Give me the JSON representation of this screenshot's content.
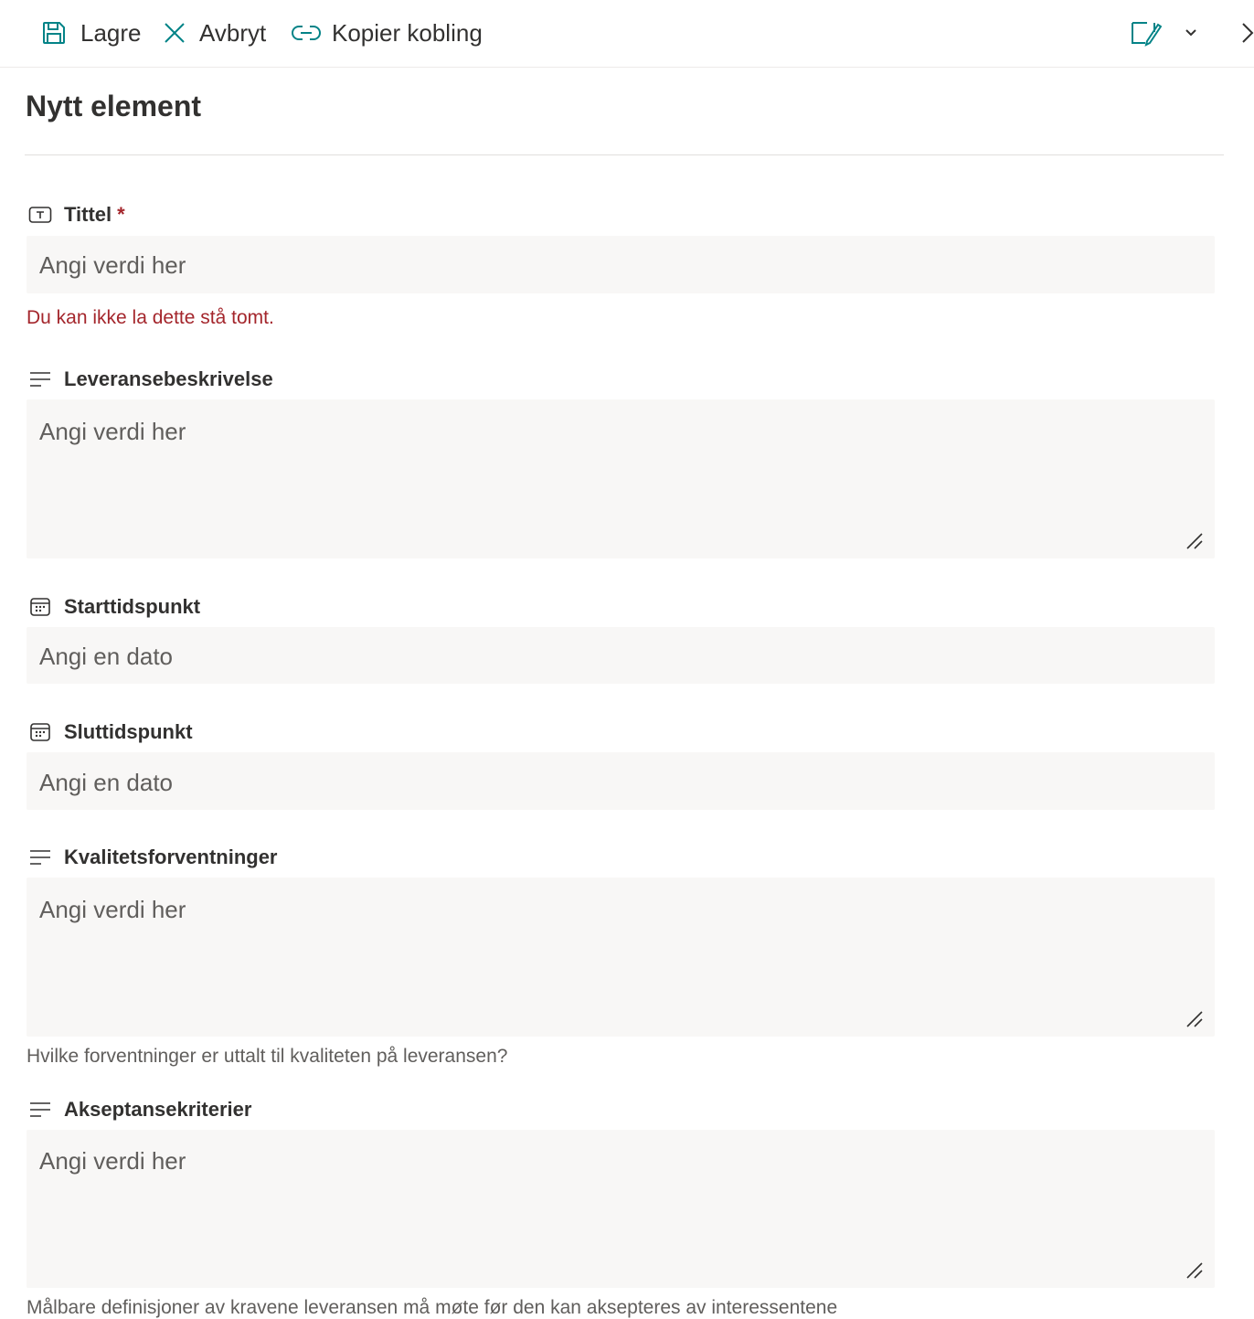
{
  "toolbar": {
    "save_label": "Lagre",
    "cancel_label": "Avbryt",
    "copy_link_label": "Kopier kobling"
  },
  "page": {
    "title": "Nytt element"
  },
  "fields": {
    "tittel": {
      "label": "Tittel",
      "required_mark": "*",
      "placeholder": "Angi verdi her",
      "error": "Du kan ikke la dette stå tomt."
    },
    "leveranse": {
      "label": "Leveransebeskrivelse",
      "placeholder": "Angi verdi her"
    },
    "start": {
      "label": "Starttidspunkt",
      "placeholder": "Angi en dato"
    },
    "slutt": {
      "label": "Sluttidspunkt",
      "placeholder": "Angi en dato"
    },
    "kvalitet": {
      "label": "Kvalitetsforventninger",
      "placeholder": "Angi verdi her",
      "description": "Hvilke forventninger er uttalt til kvaliteten på leveransen?"
    },
    "akseptanse": {
      "label": "Akseptansekriterier",
      "placeholder": "Angi verdi her",
      "description": "Målbare definisjoner av kravene leveransen må møte før den kan aksepteres av interessentene"
    }
  },
  "colors": {
    "accent": "#038387",
    "error": "#a4262c",
    "input_bg": "#f8f7f6"
  }
}
